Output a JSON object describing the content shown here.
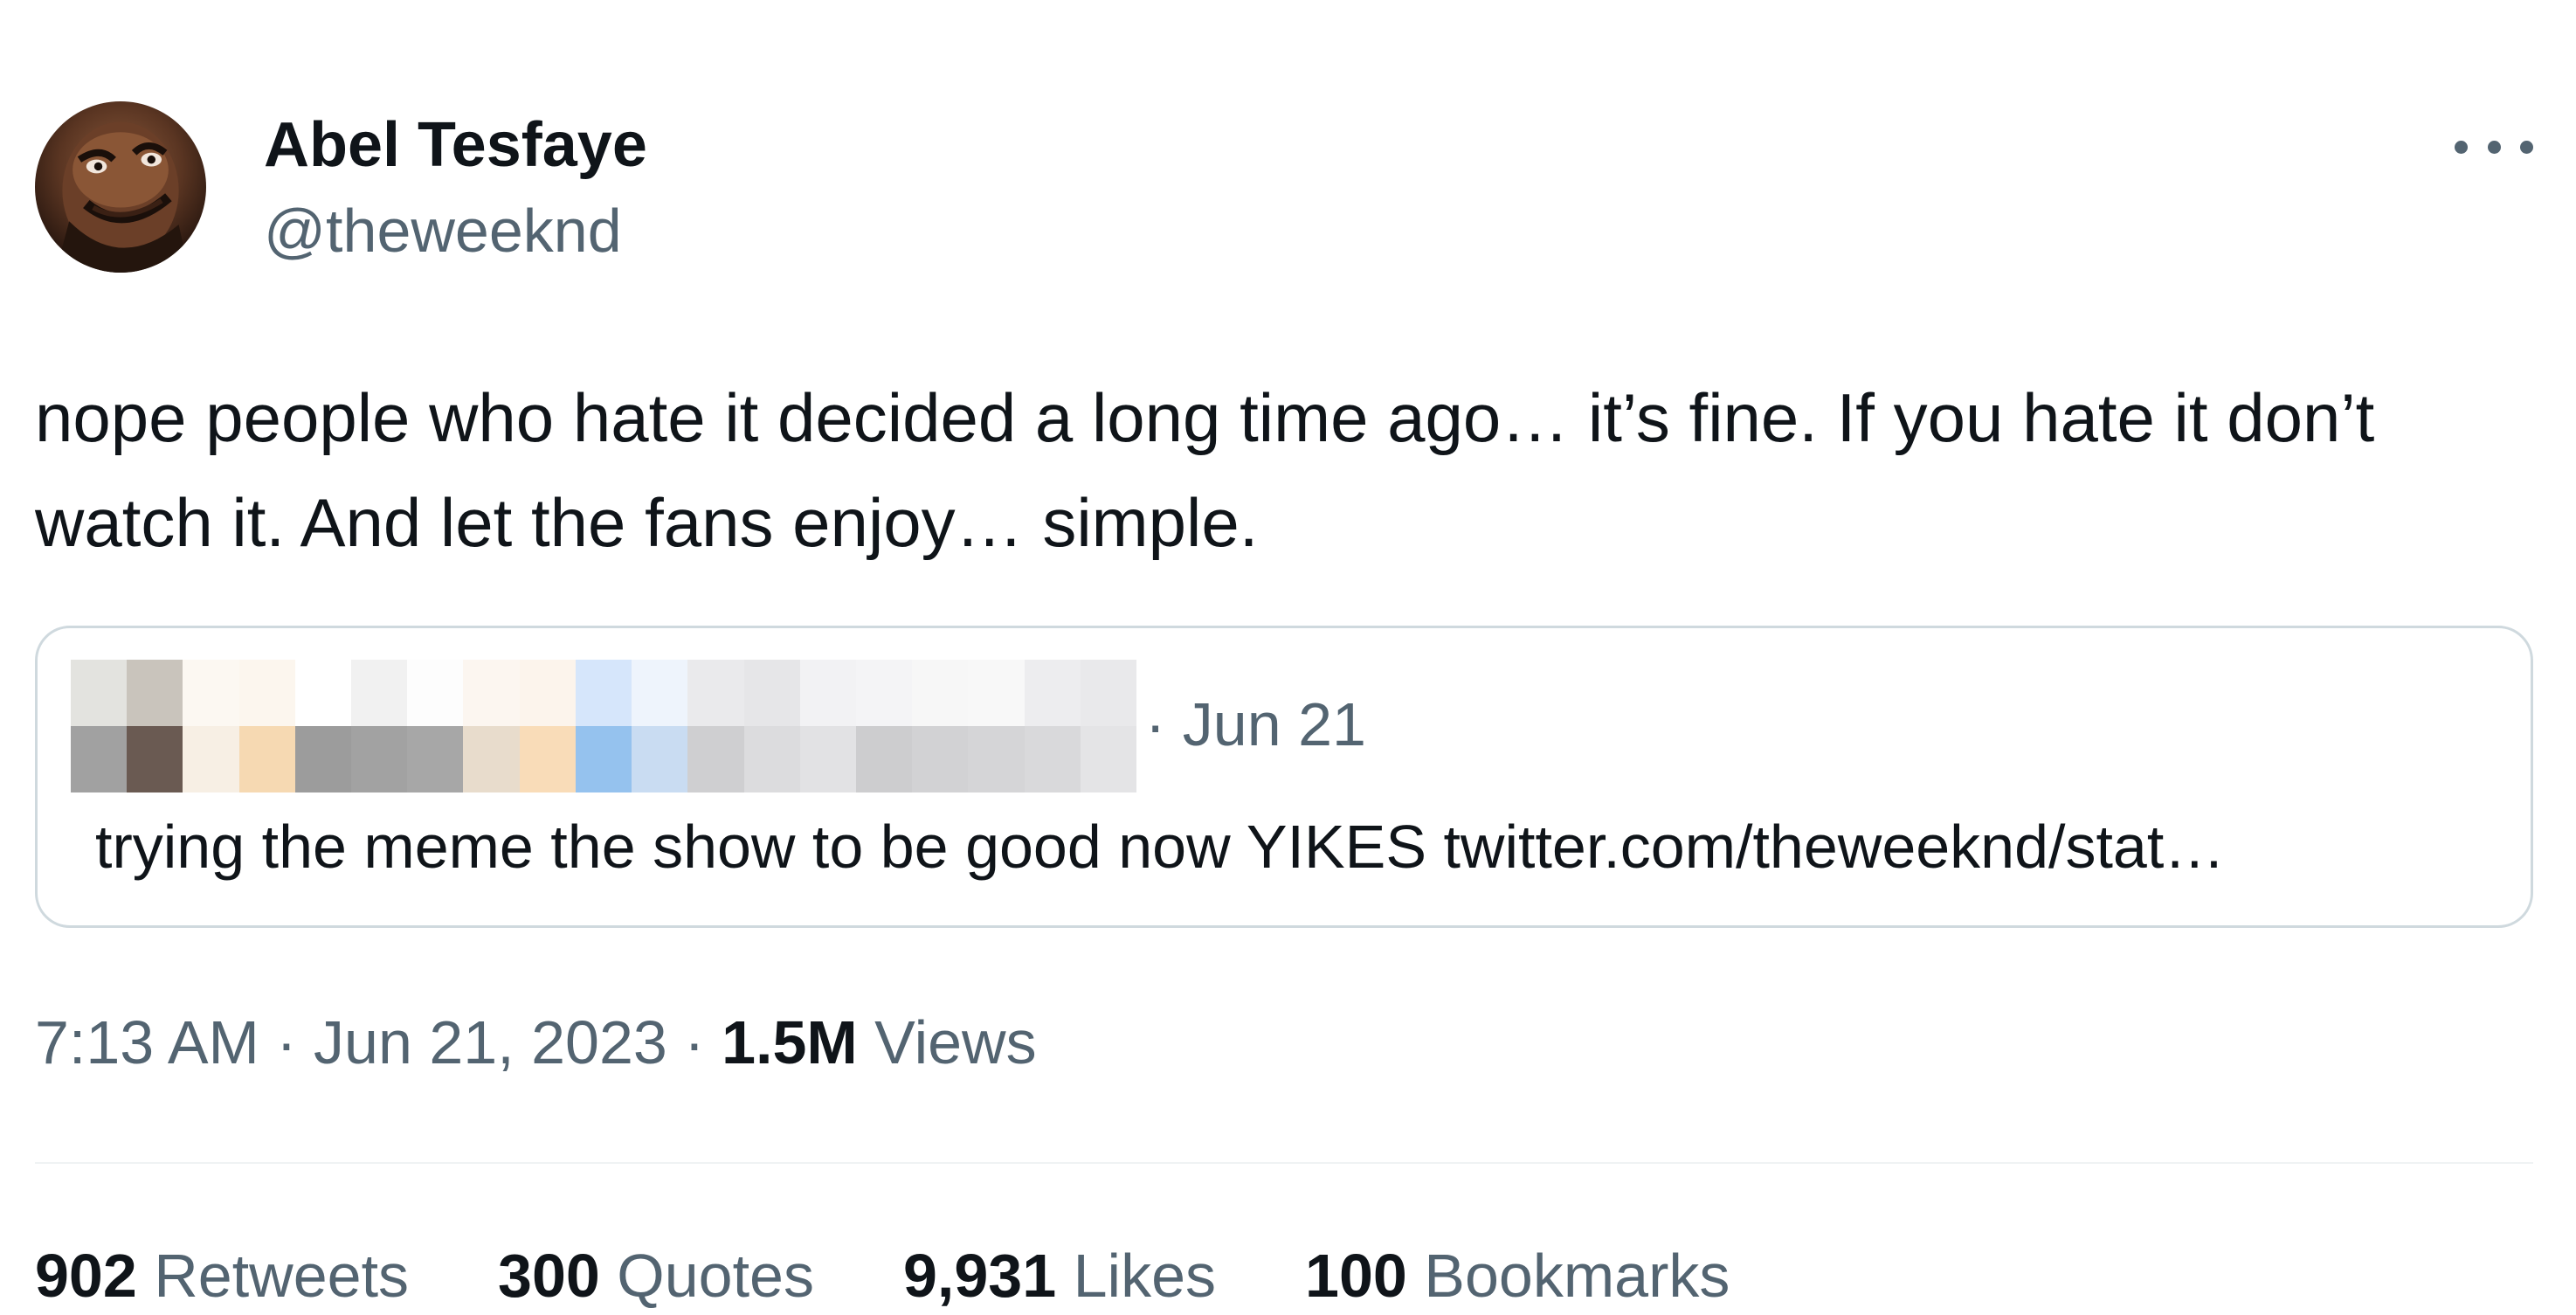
{
  "author": {
    "name": "Abel Tesfaye",
    "handle": "@theweeknd"
  },
  "tweet": {
    "text": "nope people who hate it decided a long time ago… it’s fine. If you hate it don’t watch it. And let the fans enjoy… simple."
  },
  "quoted": {
    "date": "· Jun 21",
    "text": "trying the meme the show to be good now YIKES twitter.com/theweeknd/stat…"
  },
  "meta": {
    "time": "7:13 AM",
    "date": "Jun 21, 2023",
    "views_count": "1.5M",
    "views_label": "Views"
  },
  "stats": [
    {
      "count": "902",
      "label": "Retweets"
    },
    {
      "count": "300",
      "label": "Quotes"
    },
    {
      "count": "9,931",
      "label": "Likes"
    },
    {
      "count": "100",
      "label": "Bookmarks"
    }
  ],
  "icons": {
    "more": "more-horizontal-icon"
  },
  "colors": {
    "text_primary": "#0f1419",
    "text_secondary": "#536471",
    "border": "#cfd9de"
  }
}
